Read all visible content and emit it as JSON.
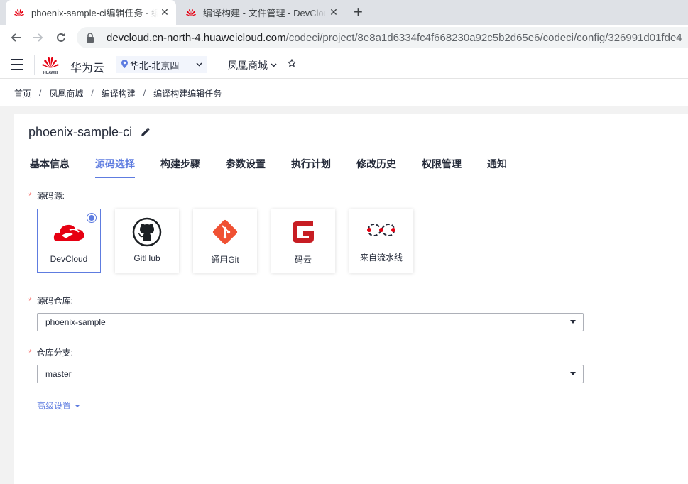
{
  "browser": {
    "tabs": [
      {
        "title": "phoenix-sample-ci编辑任务 - 编",
        "active": true
      },
      {
        "title": "编译构建 - 文件管理 - DevCloud",
        "active": false
      }
    ],
    "url_host": "devcloud.cn-north-4.huaweicloud.com",
    "url_path": "/codeci/project/8e8a1d6334fc4f668230a92c5b2d65e6/codeci/config/326991d01fde4"
  },
  "header": {
    "brand": "华为云",
    "logo_text": "HUAWEI",
    "region": "华北-北京四",
    "project": "凤凰商城"
  },
  "breadcrumb": [
    "首页",
    "凤凰商城",
    "编译构建",
    "编译构建编辑任务"
  ],
  "job": {
    "title": "phoenix-sample-ci"
  },
  "tabs": [
    "基本信息",
    "源码选择",
    "构建步骤",
    "参数设置",
    "执行计划",
    "修改历史",
    "权限管理",
    "通知"
  ],
  "active_tab": "源码选择",
  "form": {
    "source_label": "源码源:",
    "sources": [
      {
        "label": "DevCloud",
        "icon": "devcloud-icon",
        "selected": true
      },
      {
        "label": "GitHub",
        "icon": "github-icon",
        "selected": false
      },
      {
        "label": "通用Git",
        "icon": "git-icon",
        "selected": false
      },
      {
        "label": "码云",
        "icon": "gitee-icon",
        "selected": false
      },
      {
        "label": "来自流水线",
        "icon": "pipeline-icon",
        "selected": false
      }
    ],
    "repo_label": "源码仓库:",
    "repo_value": "phoenix-sample",
    "branch_label": "仓库分支:",
    "branch_value": "master",
    "advanced_label": "高级设置"
  },
  "colors": {
    "accent": "#5e7ce0",
    "required": "#f66f6a",
    "huawei_red": "#e60012"
  }
}
